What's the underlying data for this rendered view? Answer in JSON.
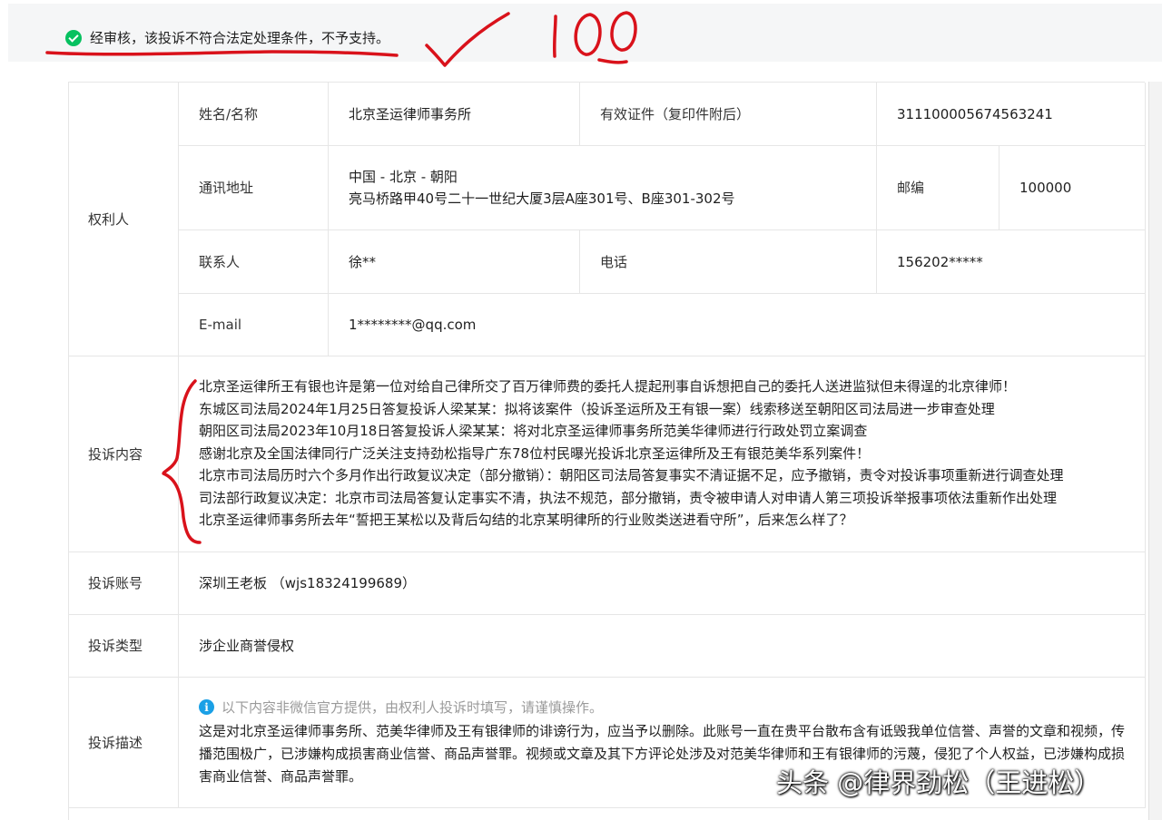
{
  "banner": {
    "message": "经审核，该投诉不符合法定处理条件，不予支持。",
    "status_color": "#07c160"
  },
  "annotation": {
    "score_text": "100",
    "ink_color": "#d9121b"
  },
  "rights_holder": {
    "group_label": "权利人",
    "name_label": "姓名/名称",
    "name_value": "北京圣运律师事务所",
    "id_label": "有效证件（复印件附后）",
    "id_value": "311100005674563241",
    "address_label": "通讯地址",
    "address_line1": "中国 - 北京 - 朝阳",
    "address_line2": "亮马桥路甲40号二十一世纪大厦3层A座301号、B座301-302号",
    "postcode_label": "邮编",
    "postcode_value": "100000",
    "contact_label": "联系人",
    "contact_value": "徐**",
    "phone_label": "电话",
    "phone_value": "156202*****",
    "email_label": "E-mail",
    "email_value": "1********@qq.com"
  },
  "complaint": {
    "content_label": "投诉内容",
    "content_lines": [
      "北京圣运律所王有银也许是第一位对给自己律所交了百万律师费的委托人提起刑事自诉想把自己的委托人送进监狱但未得逞的北京律师！",
      "东城区司法局2024年1月25日答复投诉人梁某某：拟将该案件（投诉圣运所及王有银一案）线索移送至朝阳区司法局进一步审查处理",
      "朝阳区司法局2023年10月18日答复投诉人梁某某：将对北京圣运律师事务所范美华律师进行行政处罚立案调查",
      "感谢北京及全国法律同行广泛关注支持劲松指导广东78位村民曝光投诉北京圣运律所及王有银范美华系列案件！",
      "北京市司法局历时六个多月作出行政复议决定（部分撤销）：朝阳区司法局答复事实不清证据不足，应予撤销，责令对投诉事项重新进行调查处理",
      "司法部行政复议决定：北京市司法局答复认定事实不清，执法不规范，部分撤销，责令被申请人对申请人第三项投诉举报事项依法重新作出处理",
      "北京圣运律师事务所去年“誓把王某松以及背后勾结的北京某明律所的行业败类送进看守所”，后来怎么样了？"
    ],
    "account_label": "投诉账号",
    "account_value": "深圳王老板  （wjs18324199689）",
    "type_label": "投诉类型",
    "type_value": "涉企业商誉侵权",
    "desc_label": "投诉描述",
    "desc_note": "以下内容非微信官方提供，由权利人投诉时填写，请谨慎操作。",
    "desc_text": "这是对北京圣运律师事务所、范美华律师及王有银律师的诽谤行为，应当予以删除。此账号一直在贵平台散布含有诋毁我单位信誉、声誉的文章和视频，传播范围极广，已涉嫌构成损害商业信誉、商品声誉罪。视频或文章及其下方评论处涉及对范美华律师和王有银律师的污蔑，侵犯了个人权益，已涉嫌构成损害商业信誉、商品声誉罪。"
  },
  "watermark": "头条 @律界劲松（王进松）"
}
